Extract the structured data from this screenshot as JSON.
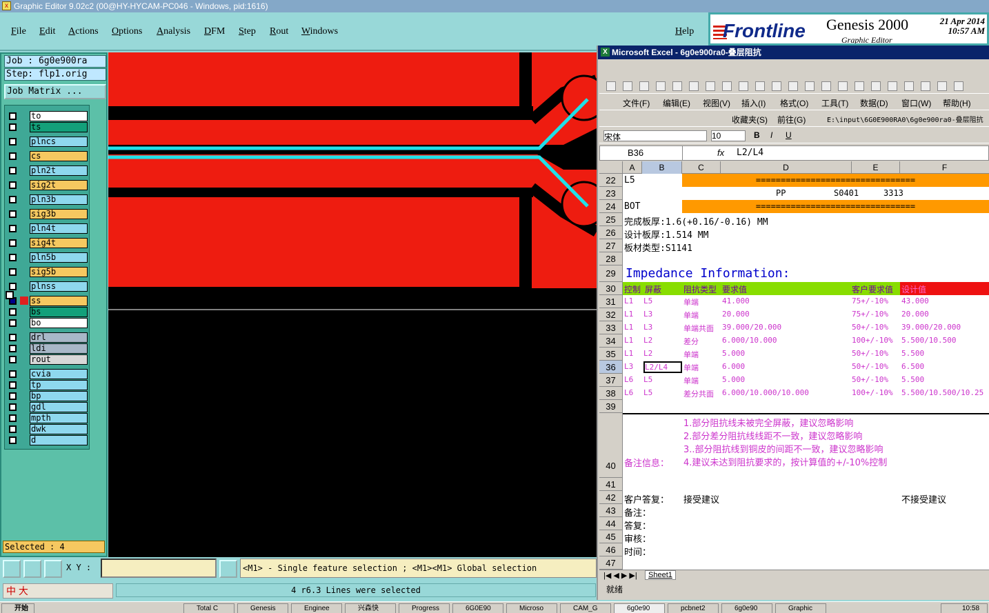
{
  "title_bar": "Graphic Editor 9.02c2 (00@HY-HYCAM-PC046 - Windows, pid:1616)",
  "menu": [
    "File",
    "Edit",
    "Actions",
    "Options",
    "Analysis",
    "DFM",
    "Step",
    "Rout",
    "Windows"
  ],
  "help": "Help",
  "brand": {
    "logo": "Frontline",
    "product": "Genesis 2000",
    "sub": "Graphic Editor",
    "date": "21 Apr 2014",
    "time": "10:57 AM"
  },
  "job": "Job : 6g0e900ra",
  "step": "Step: flp1.orig",
  "job_matrix": "Job Matrix ...",
  "layers": [
    {
      "name": "to",
      "color": "#ffffff"
    },
    {
      "name": "ts",
      "color": "#13a07a"
    },
    {
      "name": "plncs",
      "color": "#8ed8ee"
    },
    {
      "name": "cs",
      "color": "#f6c860"
    },
    {
      "name": "pln2t",
      "color": "#8ed8ee"
    },
    {
      "name": "sig2t",
      "color": "#f6c860"
    },
    {
      "name": "pln3b",
      "color": "#8ed8ee"
    },
    {
      "name": "sig3b",
      "color": "#f6c860"
    },
    {
      "name": "pln4t",
      "color": "#8ed8ee"
    },
    {
      "name": "sig4t",
      "color": "#f6c860"
    },
    {
      "name": "pln5b",
      "color": "#8ed8ee"
    },
    {
      "name": "sig5b",
      "color": "#f6c860"
    },
    {
      "name": "plnss",
      "color": "#8ed8ee"
    },
    {
      "name": "ss",
      "color": "#f6c860"
    },
    {
      "name": "bs",
      "color": "#13a07a"
    },
    {
      "name": "bo",
      "color": "#ffffff"
    },
    {
      "name": "drl",
      "color": "#a8b8c8"
    },
    {
      "name": "ldi",
      "color": "#a8b8c8"
    },
    {
      "name": "rout",
      "color": "#d8d8d8"
    },
    {
      "name": "cvia",
      "color": "#8ed8ee"
    },
    {
      "name": "tp",
      "color": "#8ed8ee"
    },
    {
      "name": "bp",
      "color": "#8ed8ee"
    },
    {
      "name": "gdl",
      "color": "#8ed8ee"
    },
    {
      "name": "mpth",
      "color": "#8ed8ee"
    },
    {
      "name": "dwk",
      "color": "#8ed8ee"
    },
    {
      "name": "d",
      "color": "#8ed8ee"
    }
  ],
  "selected": "Selected : 4",
  "xy_label": "X Y :",
  "hint": "<M1> - Single feature selection ; <M1><M1> Global selection",
  "sel_msg": "4 r6.3 Lines were selected",
  "excel": {
    "title": "Microsoft Excel - 6g0e900ra0-叠层阻抗",
    "menus": [
      "文件(F)",
      "编辑(E)",
      "视图(V)",
      "插入(I)",
      "格式(O)",
      "工具(T)",
      "数据(D)",
      "窗口(W)",
      "帮助(H)"
    ],
    "favorites": "收藏夹(S)",
    "goto": "前往(G)",
    "path": "E:\\input\\6G0E900RA0\\6g0e900ra0-叠层阻抗",
    "font": "宋体",
    "size": "10",
    "namebox": "B36",
    "fx": "fx",
    "formula": "L2/L4",
    "cols": [
      "A",
      "B",
      "C",
      "D",
      "E",
      "F"
    ],
    "r22": {
      "a": "L5",
      "bar": "================================"
    },
    "r23": {
      "pp": "PP",
      "mat": "S0401",
      "val": "3313"
    },
    "r24": {
      "a": "BOT",
      "bar": "================================"
    },
    "r25": "完成板厚:1.6(+0.16/-0.16) MM",
    "r26": "设计板厚:1.514 MM",
    "r27": "板材类型:S1141",
    "r29": "Impedance Information:",
    "r30": {
      "ctrl": "控制",
      "shield": "屏蔽",
      "type": "阻抗类型",
      "req": "要求值",
      "cust": "客户要求值",
      "design": "设计值"
    },
    "imp": [
      {
        "row": "31",
        "a": "L1",
        "b": "L5",
        "c": "单端",
        "d": "41.000",
        "e": "75+/-10%",
        "f": "43.000"
      },
      {
        "row": "32",
        "a": "L1",
        "b": "L3",
        "c": "单端",
        "d": "20.000",
        "e": "75+/-10%",
        "f": "20.000"
      },
      {
        "row": "33",
        "a": "L1",
        "b": "L3",
        "c": "单端共面",
        "d": "39.000/20.000",
        "e": "50+/-10%",
        "f": "39.000/20.000"
      },
      {
        "row": "34",
        "a": "L1",
        "b": "L2",
        "c": "差分",
        "d": "6.000/10.000",
        "e": "100+/-10%",
        "f": "5.500/10.500"
      },
      {
        "row": "35",
        "a": "L1",
        "b": "L2",
        "c": "单端",
        "d": "5.000",
        "e": "50+/-10%",
        "f": "5.500"
      },
      {
        "row": "36",
        "a": "L3",
        "b": "L2/L4",
        "c": "单端",
        "d": "6.000",
        "e": "50+/-10%",
        "f": "6.500"
      },
      {
        "row": "37",
        "a": "L6",
        "b": "L5",
        "c": "单端",
        "d": "5.000",
        "e": "50+/-10%",
        "f": "5.500"
      },
      {
        "row": "38",
        "a": "L6",
        "b": "L5",
        "c": "差分共面",
        "d": "6.000/10.000/10.000",
        "e": "100+/-10%",
        "f": "5.500/10.500/10.25"
      }
    ],
    "notes": [
      "1.部分阻抗线未被完全屏蔽，建议忽略影响",
      "2.部分差分阻抗线线距不一致，建议忽略影响",
      "3..部分阻抗线到铜皮的间距不一致，建议忽略影响",
      "4.建议未达到阻抗要求的，按计算值的+/-10%控制"
    ],
    "remark_label": "备注信息：",
    "r42": {
      "a": "客户答复：",
      "c": "接受建议",
      "f": "不接受建议"
    },
    "r43": "备注：",
    "r44": "答复：",
    "r45": "审核：",
    "r46": "时间：",
    "sheet_tab": "Sheet1",
    "status": "就绪"
  },
  "taskbar": {
    "start": "开始",
    "items": [
      "Total C",
      "Genesis",
      "Enginee",
      "兴森快",
      "Progress",
      "6G0E90",
      "Microso",
      "CAM_G",
      "6g0e90",
      "pcbnet2",
      "6g0e90",
      "Graphic"
    ],
    "clock": "10:58"
  },
  "ime": "中 大"
}
